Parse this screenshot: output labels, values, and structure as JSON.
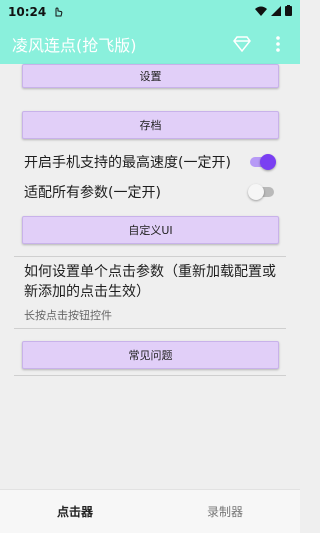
{
  "status_bar": {
    "time": "10:24"
  },
  "app_bar": {
    "title": "凌风连点(抢飞版)"
  },
  "buttons": {
    "settings": "设置",
    "archive": "存档",
    "custom_ui": "自定义UI",
    "faq": "常见问题"
  },
  "toggles": [
    {
      "label": "开启手机支持的最高速度(一定开)",
      "checked": true
    },
    {
      "label": "适配所有参数(一定开)",
      "checked": false
    }
  ],
  "help": {
    "title": "如何设置单个点击参数（重新加载配置或新添加的点击生效）",
    "subtitle": "长按点击按钮控件"
  },
  "bottom_nav": {
    "items": [
      {
        "label": "点击器",
        "active": true
      },
      {
        "label": "录制器",
        "active": false
      }
    ]
  },
  "colors": {
    "primary": "#8af0dc",
    "button_bg": "#e1cff8",
    "switch_accent": "#7a3ff2"
  }
}
